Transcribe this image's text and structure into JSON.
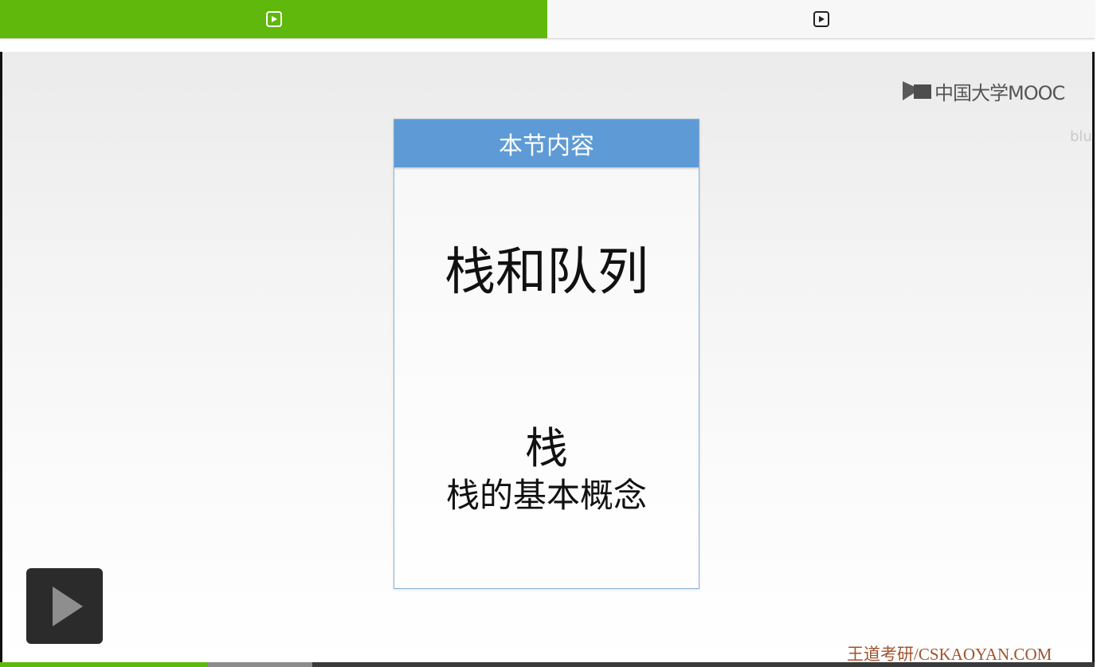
{
  "tabs": [
    {
      "icon": "play-icon",
      "active": true
    },
    {
      "icon": "play-icon",
      "active": false
    }
  ],
  "video": {
    "logo_text": "中国大学MOOC",
    "overlay_text": "blu",
    "slide": {
      "header": "本节内容",
      "title": "栈和队列",
      "sub1": "栈",
      "sub2": "栈的基本概念"
    },
    "watermark": "王道考研/CSKAOYAN.COM",
    "play_button_icon": "play-icon",
    "progress": {
      "played_fraction": 0.19,
      "buffered_fraction": 0.285
    }
  },
  "colors": {
    "accent_green": "#5fb80b",
    "slide_header_blue": "#5e9bd6",
    "watermark_brown": "#a0522d"
  }
}
